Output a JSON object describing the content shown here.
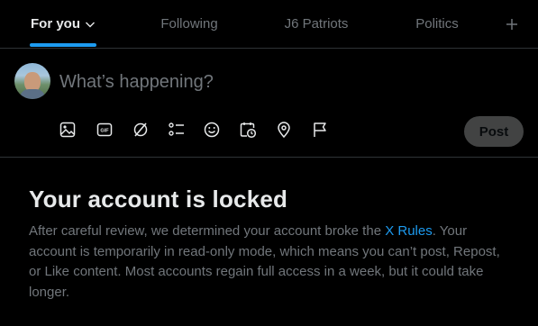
{
  "tabs": [
    {
      "label": "For you",
      "active": true
    },
    {
      "label": "Following",
      "active": false
    },
    {
      "label": "J6 Patriots",
      "active": false
    },
    {
      "label": "Politics",
      "active": false
    }
  ],
  "tab_add_icon": "plus-icon",
  "composer": {
    "placeholder": "What’s happening?",
    "tools": [
      "image-icon",
      "gif-icon",
      "grok-icon",
      "poll-icon",
      "emoji-icon",
      "schedule-icon",
      "location-icon",
      "flag-icon"
    ],
    "post_label": "Post"
  },
  "notice": {
    "title": "Your account is locked",
    "body_before_link": "After careful review, we determined your account broke the ",
    "link_text": "X Rules",
    "body_after_link": ". Your account is temporarily in read-only mode, which means you can’t post, Repost, or Like content. Most accounts regain full access in a week, but it could take longer."
  },
  "colors": {
    "background": "#000000",
    "accent": "#1d9bf0",
    "text_primary": "#e7e9ea",
    "text_secondary": "#71767b",
    "divider": "#2f3336"
  }
}
